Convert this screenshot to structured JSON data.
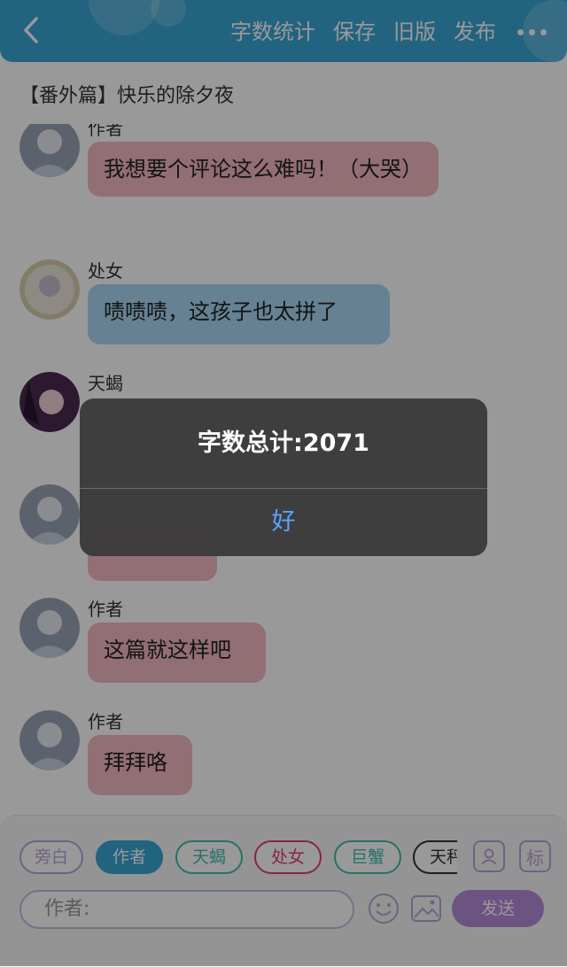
{
  "header": {
    "actions": [
      "字数统计",
      "保存",
      "旧版",
      "发布"
    ],
    "background": "#3aa6d6"
  },
  "story": {
    "title": "【番外篇】快乐的除夕夜"
  },
  "chat": {
    "messages": [
      {
        "name": "作者",
        "text": "我想要个评论这么难吗！（大哭）",
        "bubble_color": "pink"
      },
      {
        "name": "处女",
        "text": "啧啧啧，这孩子也太拼了",
        "bubble_color": "blue"
      },
      {
        "name": "天蝎",
        "text": "",
        "bubble_color": "pink"
      },
      {
        "name": "",
        "text": "",
        "bubble_color": "pink"
      },
      {
        "name": "作者",
        "text": "这篇就这样吧",
        "bubble_color": "pink"
      },
      {
        "name": "作者",
        "text": "拜拜咯",
        "bubble_color": "pink"
      }
    ]
  },
  "bottom": {
    "roles": [
      {
        "label": "旁白",
        "color": "#b8a4dc",
        "selected": false
      },
      {
        "label": "作者",
        "color": "#3aa6d6",
        "selected": true
      },
      {
        "label": "天蝎",
        "color": "#3dbfae",
        "selected": false
      },
      {
        "label": "处女",
        "color": "#e0407a",
        "selected": false
      },
      {
        "label": "巨蟹",
        "color": "#3dbfae",
        "selected": false
      },
      {
        "label": "天秤",
        "color": "#333333",
        "selected": false
      }
    ],
    "tag_label": "标",
    "input_placeholder": "作者:",
    "send_label": "发送"
  },
  "dialog": {
    "message": "字数总计:2071",
    "ok_label": "好"
  }
}
